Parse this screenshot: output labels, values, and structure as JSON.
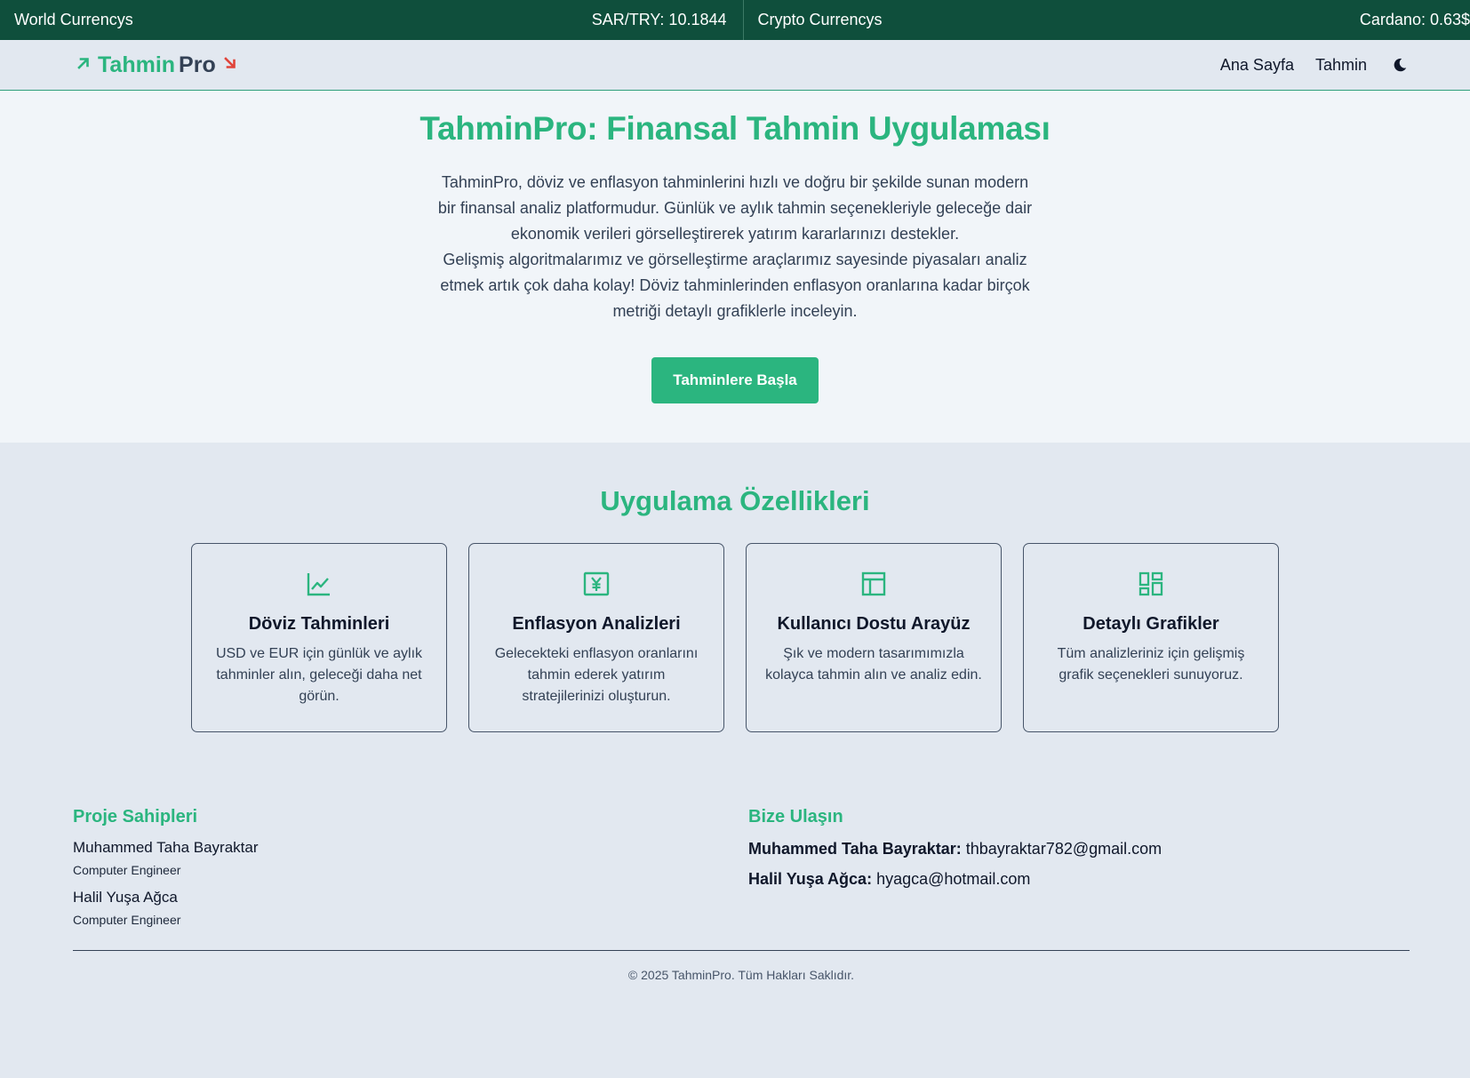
{
  "ticker": {
    "left_title": "World Currencys",
    "left_rate": "SAR/TRY: 10.1844",
    "right_title": "Crypto Currencys",
    "right_rate": "Cardano: 0.63$"
  },
  "nav": {
    "logo_part1": "Tahmin",
    "logo_part2": "Pro",
    "logo_up_icon": "arrow-up-right-icon",
    "logo_down_icon": "arrow-down-right-icon",
    "links": [
      "Ana Sayfa",
      "Tahmin"
    ],
    "theme_icon": "moon-icon"
  },
  "hero": {
    "title": "TahminPro: Finansal Tahmin Uygulaması",
    "paragraph1": "TahminPro, döviz ve enflasyon tahminlerini hızlı ve doğru bir şekilde sunan modern bir finansal analiz platformudur. Günlük ve aylık tahmin seçenekleriyle geleceğe dair ekonomik verileri görselleştirerek yatırım kararlarınızı destekler.",
    "paragraph2": "Gelişmiş algoritmalarımız ve görselleştirme araçlarımız sayesinde piyasaları analiz etmek artık çok daha kolay! Döviz tahminlerinden enflasyon oranlarına kadar birçok metriği detaylı grafiklerle inceleyin.",
    "cta": "Tahminlere Başla"
  },
  "features": {
    "title": "Uygulama Özellikleri",
    "cards": [
      {
        "icon": "line-chart-icon",
        "title": "Döviz Tahminleri",
        "text": "USD ve EUR için günlük ve aylık tahminler alın, geleceği daha net görün."
      },
      {
        "icon": "yen-bill-icon",
        "title": "Enflasyon Analizleri",
        "text": "Gelecekteki enflasyon oranlarını tahmin ederek yatırım stratejilerinizi oluşturun."
      },
      {
        "icon": "layout-icon",
        "title": "Kullanıcı Dostu Arayüz",
        "text": "Şık ve modern tasarımımızla kolayca tahmin alın ve analiz edin."
      },
      {
        "icon": "dashboard-grid-icon",
        "title": "Detaylı Grafikler",
        "text": "Tüm analizleriniz için gelişmiş grafik seçenekleri sunuyoruz."
      }
    ]
  },
  "footer": {
    "owners_title": "Proje Sahipleri",
    "owners": [
      {
        "name": "Muhammed Taha Bayraktar",
        "role": "Computer Engineer"
      },
      {
        "name": "Halil Yuşa Ağca",
        "role": "Computer Engineer"
      }
    ],
    "contact_title": "Bize Ulaşın",
    "contacts": [
      {
        "name": "Muhammed Taha Bayraktar:",
        "email": "thbayraktar782@gmail.com"
      },
      {
        "name": "Halil Yuşa Ağca:",
        "email": "hyagca@hotmail.com"
      }
    ],
    "copyright": "© 2025 TahminPro. Tüm Hakları Saklıdır."
  },
  "colors": {
    "accent": "#2bb57f",
    "ticker_bg": "#0f4f3c",
    "down_arrow": "#e0443a"
  }
}
